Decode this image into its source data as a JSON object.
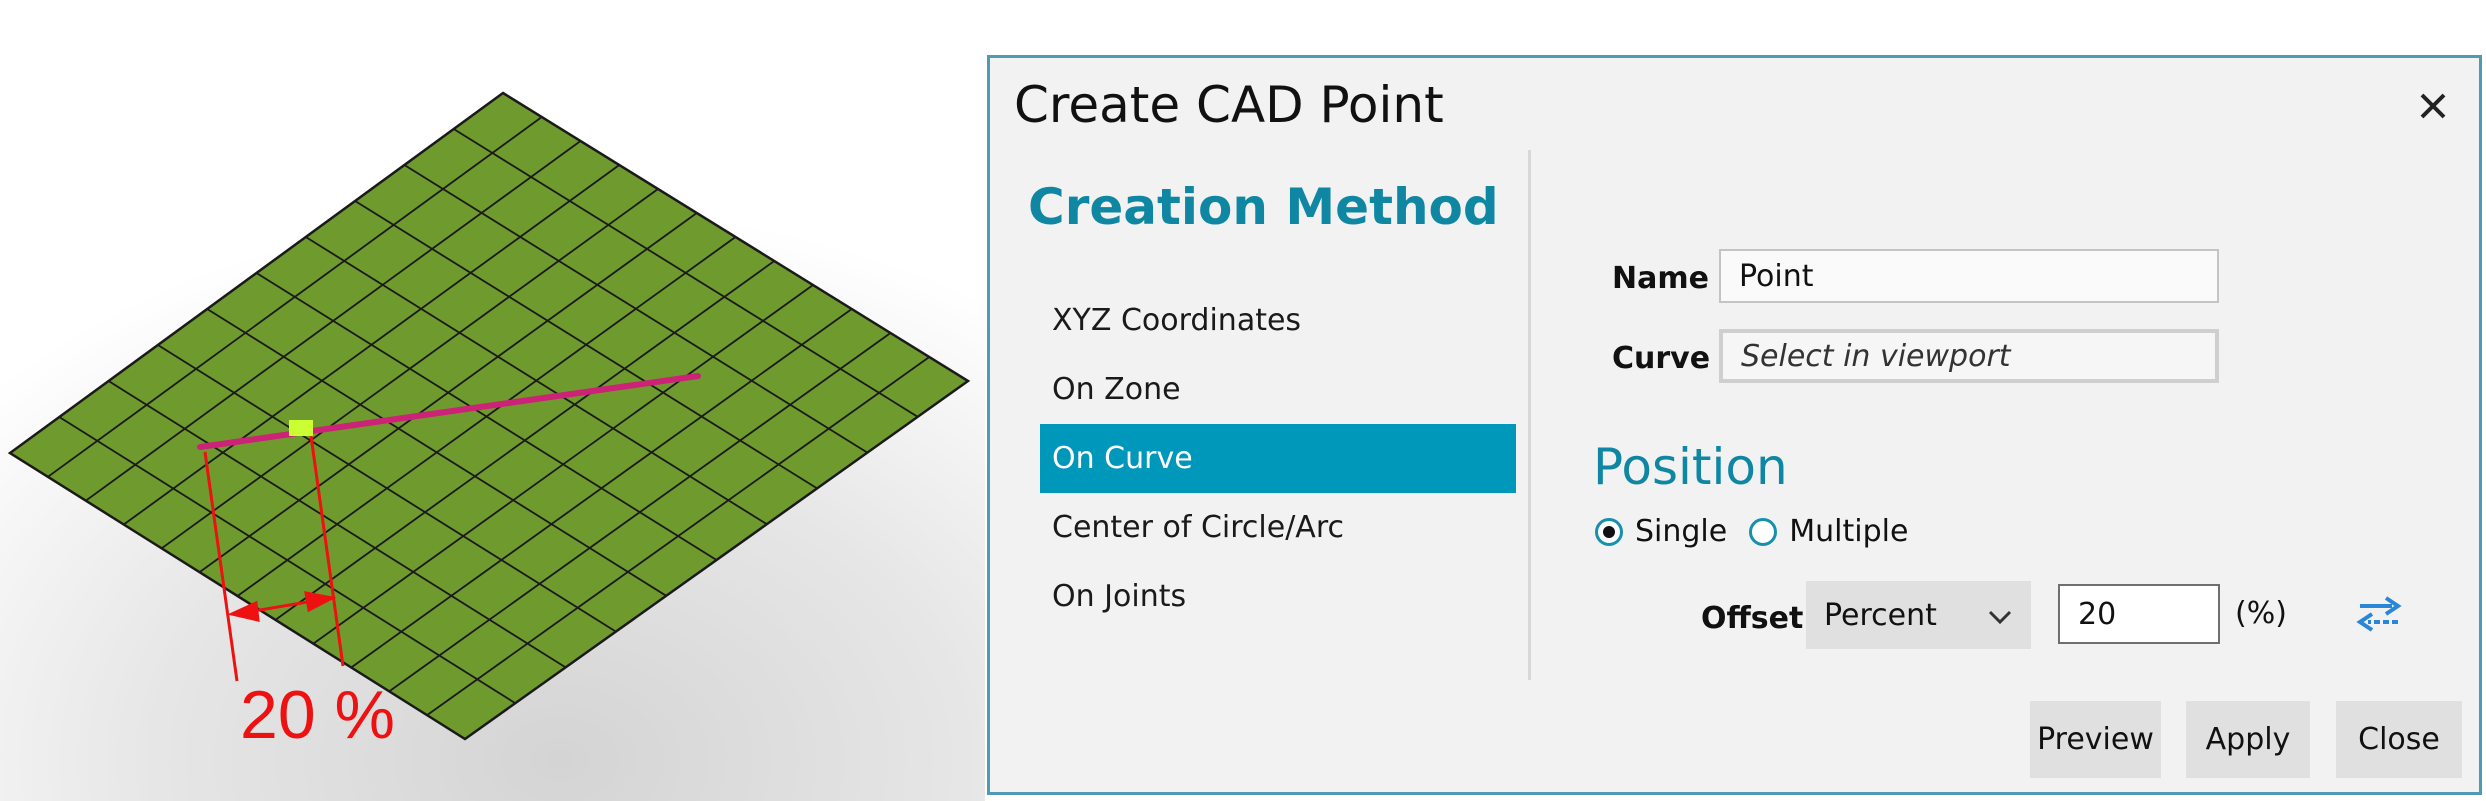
{
  "viewport": {
    "annotation": "20 %",
    "colors": {
      "surface": "#6f9a2d",
      "grid": "#1a1a1a",
      "curve": "#cc2277",
      "point": "#ccff33",
      "annotation": "#ee1111"
    }
  },
  "dialog": {
    "title": "Create CAD Point",
    "close_icon": "close-icon",
    "creation_method": {
      "heading": "Creation Method",
      "items": [
        {
          "label": "XYZ Coordinates",
          "selected": false
        },
        {
          "label": "On Zone",
          "selected": false
        },
        {
          "label": "On Curve",
          "selected": true
        },
        {
          "label": "Center of Circle/Arc",
          "selected": false
        },
        {
          "label": "On Joints",
          "selected": false
        }
      ]
    },
    "name": {
      "label": "Name",
      "value": "Point"
    },
    "curve": {
      "label": "Curve",
      "value": "Select in viewport"
    },
    "position": {
      "heading": "Position",
      "options": [
        {
          "label": "Single",
          "checked": true
        },
        {
          "label": "Multiple",
          "checked": false
        }
      ],
      "offset": {
        "label": "Offset",
        "mode": "Percent",
        "value": "20",
        "unit": "(%)",
        "swap_icon": "swap-direction-icon"
      }
    },
    "buttons": {
      "preview": "Preview",
      "apply": "Apply",
      "close": "Close"
    },
    "colors": {
      "accent": "#0f87a3",
      "selected_bg": "#0098ba",
      "border": "#4f9ab5"
    }
  }
}
